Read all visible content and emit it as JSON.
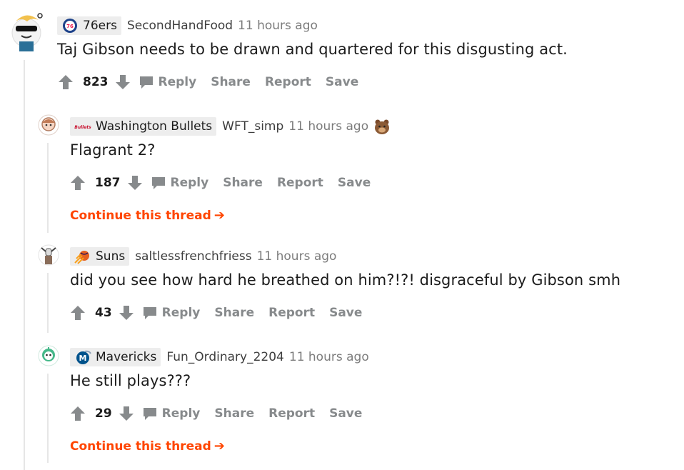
{
  "comments": [
    {
      "flair": "76ers",
      "username": "SecondHandFood",
      "time": "11 hours ago",
      "body": "Taj Gibson needs to be drawn and quartered for this disgusting act.",
      "score": "823",
      "actions": {
        "reply": "Reply",
        "share": "Share",
        "report": "Report",
        "save": "Save"
      }
    },
    {
      "flair": "Washington Bullets",
      "flair_logo_text": "Bullets",
      "username": "WFT_simp",
      "time": "11 hours ago",
      "body": "Flagrant 2?",
      "score": "187",
      "actions": {
        "reply": "Reply",
        "share": "Share",
        "report": "Report",
        "save": "Save"
      },
      "continue": "Continue this thread"
    },
    {
      "flair": "Suns",
      "username": "saltlessfrenchfriess",
      "time": "11 hours ago",
      "body": "did you see how hard he breathed on him?!?! disgraceful by Gibson smh",
      "score": "43",
      "actions": {
        "reply": "Reply",
        "share": "Share",
        "report": "Report",
        "save": "Save"
      }
    },
    {
      "flair": "Mavericks",
      "username": "Fun_Ordinary_2204",
      "time": "11 hours ago",
      "body": "He still plays???",
      "score": "29",
      "actions": {
        "reply": "Reply",
        "share": "Share",
        "report": "Report",
        "save": "Save"
      },
      "continue": "Continue this thread"
    }
  ],
  "icons": {
    "upvote": "upvote-arrow-icon",
    "downvote": "downvote-arrow-icon",
    "reply": "speech-bubble-icon",
    "continue": "right-arrow-icon",
    "award": "bear-award-icon"
  },
  "colors": {
    "accent": "#ff4500",
    "meta": "#7c7c7c",
    "action": "#878a8c",
    "thread_line": "#e6e6e6",
    "flair_bg": "#ededed"
  }
}
